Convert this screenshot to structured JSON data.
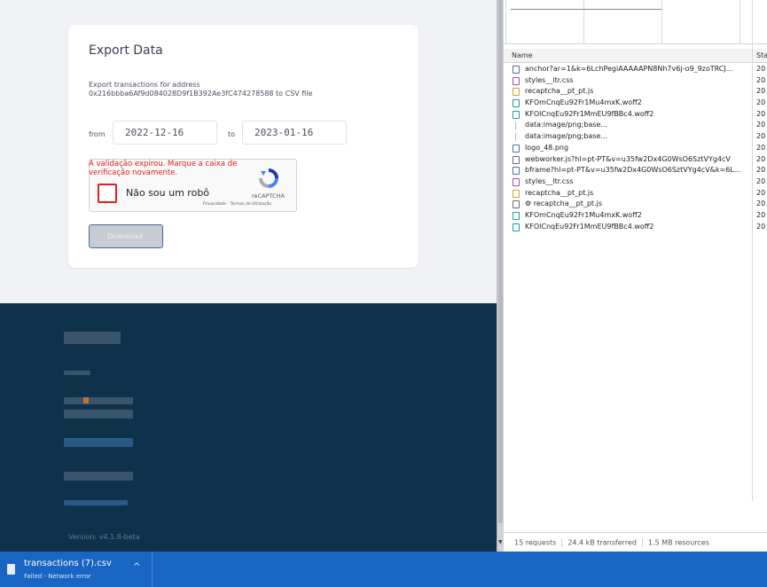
{
  "export": {
    "title": "Export Data",
    "desc_line1": "Export transactions for address",
    "desc_line2": "0x216bbba6Af9d084028D9f1B392Ae3fC474278588 to CSV file",
    "from_label": "from",
    "from_value": "2022-12-16",
    "to_label": "to",
    "to_value": "2023-01-16",
    "download_label": "Download"
  },
  "captcha": {
    "error": "A validação expirou. Marque a caixa de verificação novamente.",
    "checkbox_label": "Não sou um robô",
    "brand": "reCAPTCHA",
    "links": "Privacidade - Termos de Utilização"
  },
  "footer": {
    "version": "Version: v4.1.8-beta"
  },
  "network": {
    "col_name": "Name",
    "col_status": "Sta",
    "requests": [
      {
        "name": "anchor?ar=1&k=6LchPegiAAAAAPN8Nh7v6j-o9_9zoTRCJ...",
        "status": "20",
        "icon": "doc-icon",
        "color": "#4a6fb5"
      },
      {
        "name": "styles__ltr.css",
        "status": "20",
        "icon": "css-icon",
        "color": "#a34bbf"
      },
      {
        "name": "recaptcha__pt_pt.js",
        "status": "20",
        "icon": "js-icon",
        "color": "#e0a020"
      },
      {
        "name": "KFOmCnqEu92Fr1Mu4mxK.woff2",
        "status": "20",
        "icon": "font-icon",
        "color": "#1aa0a0"
      },
      {
        "name": "KFOlCnqEu92Fr1MmEU9fBBc4.woff2",
        "status": "20",
        "icon": "font-icon",
        "color": "#1aa0a0"
      },
      {
        "name": "data:image/png;base...",
        "status": "20",
        "icon": "data-icon",
        "color": "#bbbbbb"
      },
      {
        "name": "data:image/png;base...",
        "status": "20",
        "icon": "data-icon",
        "color": "#bbbbbb"
      },
      {
        "name": "logo_48.png",
        "status": "20",
        "icon": "image-icon",
        "color": "#4a6fb5"
      },
      {
        "name": "webworker.js?hl=pt-PT&v=u35fw2Dx4G0WsO6SztVYg4cV",
        "status": "20",
        "icon": "file-icon",
        "color": "#6b6b6b"
      },
      {
        "name": "bframe?hl=pt-PT&v=u35fw2Dx4G0WsO6SztVYg4cV&k=6L...",
        "status": "20",
        "icon": "doc-icon",
        "color": "#4a6fb5"
      },
      {
        "name": "styles__ltr.css",
        "status": "20",
        "icon": "css-icon",
        "color": "#a34bbf"
      },
      {
        "name": "recaptcha__pt_pt.js",
        "status": "20",
        "icon": "js-icon",
        "color": "#e0a020"
      },
      {
        "name": "⚙ recaptcha__pt_pt.js",
        "status": "20",
        "icon": "file-icon",
        "color": "#6b6b6b"
      },
      {
        "name": "KFOmCnqEu92Fr1Mu4mxK.woff2",
        "status": "20",
        "icon": "font-icon",
        "color": "#1aa0a0"
      },
      {
        "name": "KFOlCnqEu92Fr1MmEU9fBBc4.woff2",
        "status": "20",
        "icon": "font-icon",
        "color": "#1aa0a0"
      }
    ],
    "summary_requests": "15 requests",
    "summary_transferred": "24.4 kB transferred",
    "summary_resources": "1.5 MB resources"
  },
  "download_bar": {
    "file_name": "transactions (7).csv",
    "file_status": "Failed - Network error"
  }
}
